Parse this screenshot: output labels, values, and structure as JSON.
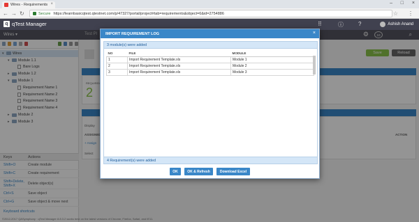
{
  "browser": {
    "tab_title": "Wires - Requirements",
    "secure_label": "Secure",
    "url": "https://learnbasicqtest.qtestnet.com/p/47327/portal/project#tab=requirements&object=6&id=2754886"
  },
  "app": {
    "brand": "qTest Manager",
    "logo_letter": "q",
    "user_name": "Ashish Anand",
    "project_name": "Wires ▾",
    "test_plan_label": "Test Pl",
    "notification_count": "10"
  },
  "tree": {
    "nodes": [
      {
        "label": "Wires",
        "level": 0,
        "type": "root"
      },
      {
        "label": "Module 1.1",
        "level": 1,
        "type": "folder"
      },
      {
        "label": "Bare Logs",
        "level": 2,
        "type": "req"
      },
      {
        "label": "Module 1.2",
        "level": 1,
        "type": "folder"
      },
      {
        "label": "Module 1",
        "level": 1,
        "type": "folder"
      },
      {
        "label": "Requirement Name 1",
        "level": 2,
        "type": "req"
      },
      {
        "label": "Requirement Name 2",
        "level": 2,
        "type": "req"
      },
      {
        "label": "Requirement Name 3",
        "level": 2,
        "type": "req"
      },
      {
        "label": "Requirement Name 4",
        "level": 2,
        "type": "req"
      },
      {
        "label": "Module 2",
        "level": 1,
        "type": "folder"
      },
      {
        "label": "Module 3",
        "level": 1,
        "type": "folder"
      }
    ]
  },
  "keys": {
    "header_keys": "Keys",
    "header_actions": "Actions",
    "rows": [
      {
        "key": "Shift+O",
        "action": "Create module"
      },
      {
        "key": "Shift+C",
        "action": "Create requirement"
      },
      {
        "key": "Shift+Delete, Shift+X",
        "action": "Delete object(s)"
      },
      {
        "key": "Ctrl+S",
        "action": "Save object"
      },
      {
        "key": "Ctrl+G",
        "action": "Save object & move next"
      }
    ],
    "shortcuts_link": "Keyboard shortcuts"
  },
  "footer_text": "©2012-2017 QASymphony · qTest Manager 8.8.3.2 works best on the latest versions of Chrome, Firefox, Safari, and IE11.",
  "background": {
    "save_label": "Save",
    "reload_label": "Reload",
    "requirements_count": "2",
    "requirements_label": "REQUIREMENTS",
    "display_label": "Display",
    "assigned_label": "ASSIGNED",
    "action_label": "ACTION",
    "add_label": "+ Assign",
    "select_label": "Select"
  },
  "modal": {
    "title": "IMPORT REQUIREMENT LOG",
    "top_message": "3 module(s) were added",
    "columns": [
      "NO",
      "FILE",
      "MODULE"
    ],
    "rows": [
      {
        "no": "1",
        "file": "Import Requirement Template.xls",
        "module": "Module 1"
      },
      {
        "no": "2",
        "file": "Import Requirement Template.xls",
        "module": "Module 2"
      },
      {
        "no": "3",
        "file": "Import Requirement Template.xls",
        "module": "Module 3"
      }
    ],
    "bottom_message": "4 Requirement(s) were added",
    "buttons": {
      "ok": "OK",
      "ok_refresh": "OK & Refresh",
      "download": "Download Excel"
    }
  }
}
